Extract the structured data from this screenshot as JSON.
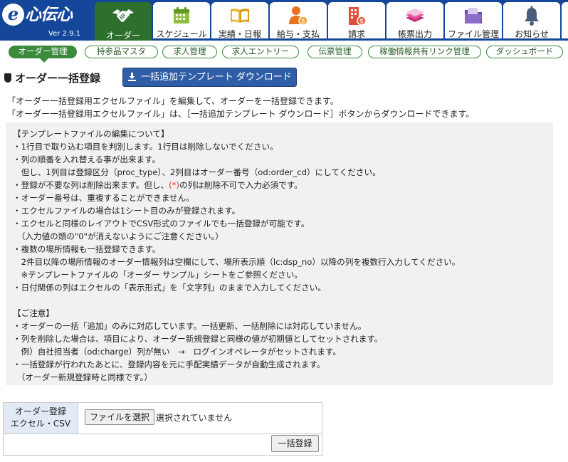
{
  "app": {
    "logo_mark": "e",
    "logo_text": "心伝心",
    "version": "Ver 2.9.1"
  },
  "main_tabs": [
    {
      "label": "オーダー",
      "icon": "handshake-icon",
      "active": true
    },
    {
      "label": "スケジュール",
      "icon": "calendar-icon"
    },
    {
      "label": "実績・日報",
      "icon": "book-icon"
    },
    {
      "label": "給与・支払",
      "icon": "payroll-person-icon"
    },
    {
      "label": "請求",
      "icon": "building-coin-icon"
    },
    {
      "label": "帳票出力",
      "icon": "document-stack-icon"
    },
    {
      "label": "ファイル管理",
      "icon": "folder-icon"
    },
    {
      "label": "お知らせ",
      "icon": "bell-icon"
    }
  ],
  "sub_tabs": [
    {
      "label": "オーダー管理",
      "active": true
    },
    {
      "label": "持参品マスタ"
    },
    {
      "label": "求人管理"
    },
    {
      "label": "求人エントリー"
    },
    {
      "label": "伝票管理"
    },
    {
      "label": "稼働情報共有リンク管理"
    },
    {
      "label": "ダッシュボード"
    }
  ],
  "page": {
    "title": "オーダー一括登録",
    "download_button": "一括追加テンプレート ダウンロード",
    "intro": [
      "「オーダー一括登録用エクセルファイル」を編集して、オーダーを一括登録できます。",
      "「オーダー一括登録用エクセルファイル」は、［一括追加テンプレート ダウンロード］ボタンからダウンロードできます。"
    ]
  },
  "notes": {
    "template_heading": "【テンプレートファイルの編集について】",
    "template_lines": [
      "・1行目で取り込む項目を判別します。1行目は削除しないでください。",
      "・列の順番を入れ替える事が出来ます。",
      "　但し、1列目は登録区分（proc_type）、2列目はオーダー番号（od:order_cd）にしてください。",
      "・登録が不要な列は削除出来ます。但し、",
      "・オーダー番号は、重複することができません。",
      "・エクセルファイルの場合は1シート目のみが登録されます。",
      "・エクセルと同様のレイアウトでCSV形式のファイルでも一括登録が可能です。",
      "　（入力値の頭の\"0\"が消えないようにご注意ください。）",
      "・複数の場所情報も一括登録できます。",
      "　2件目以降の場所情報のオーダー情報列は空欄にして、場所表示順（lc:dsp_no）以降の列を複数行入力してください。",
      "　※テンプレートファイルの「オーダー サンプル」シートをご参照ください。",
      "・日付関係の列はエクセルの「表示形式」を「文字列」のままで入力してください。"
    ],
    "required_mark": "(*)",
    "required_suffix": "の列は削除不可で入力必須です。",
    "caution_heading": "【ご注意】",
    "caution_lines": [
      "・オーダーの一括「追加」のみに対応しています。一括更新、一括削除には対応していません。",
      "・列を削除した場合は、項目により、オーダー新規登録と同様の値が初期値としてセットされます。",
      "　例）自社担当者（od:charge）列が無い　→　ログインオペレータがセットされます。",
      "・一括登録が行われたあとに、登録内容を元に手配実績データが自動生成されます。",
      "　（オーダー新規登録時と同様です。）"
    ]
  },
  "form": {
    "label_line1": "オーダー登録",
    "label_line2": "エクセル・CSV",
    "file_button": "ファイルを選択",
    "file_status": "選択されていません",
    "submit_button": "一括登録"
  },
  "colors": {
    "header_blue": "#14479a",
    "active_green": "#2d6f2c",
    "pill_green": "#3c8b3c",
    "download_blue": "#2f5ea6",
    "required_red": "#e3322b"
  }
}
